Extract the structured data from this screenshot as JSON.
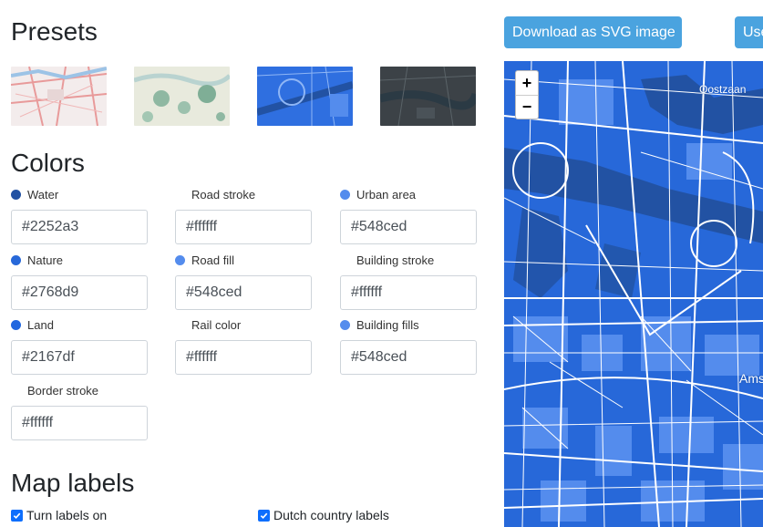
{
  "presets": {
    "title": "Presets",
    "items": [
      {
        "name": "preset-light"
      },
      {
        "name": "preset-nature"
      },
      {
        "name": "preset-blue"
      },
      {
        "name": "preset-dark"
      }
    ]
  },
  "colors": {
    "title": "Colors",
    "fields": [
      {
        "label": "Water",
        "value": "#2252a3",
        "dot": "#2252a3"
      },
      {
        "label": "Road stroke",
        "value": "#ffffff",
        "dot": null
      },
      {
        "label": "Urban area",
        "value": "#548ced",
        "dot": "#548ced"
      },
      {
        "label": "Nature",
        "value": "#2768d9",
        "dot": "#2768d9"
      },
      {
        "label": "Road fill",
        "value": "#548ced",
        "dot": "#548ced"
      },
      {
        "label": "Building stroke",
        "value": "#ffffff",
        "dot": null
      },
      {
        "label": "Land",
        "value": "#2167df",
        "dot": "#2167df"
      },
      {
        "label": "Rail color",
        "value": "#ffffff",
        "dot": null
      },
      {
        "label": "Building fills",
        "value": "#548ced",
        "dot": "#548ced"
      },
      {
        "label": "Border stroke",
        "value": "#ffffff",
        "dot": null
      }
    ]
  },
  "map_labels": {
    "title": "Map labels",
    "turn_on": "Turn labels on",
    "dutch": "Dutch country labels"
  },
  "buttons": {
    "download": "Download as SVG image",
    "use": "Use"
  },
  "map": {
    "zoom_in": "+",
    "zoom_out": "−",
    "label_oostzaan": "Oostzaan",
    "label_ams": "Ams"
  },
  "theme": {
    "water": "#2252a3",
    "urban": "#548ced",
    "land": "#2167df",
    "road": "#ffffff",
    "button": "#4aa3df",
    "checkbox": "#0d6efd"
  }
}
